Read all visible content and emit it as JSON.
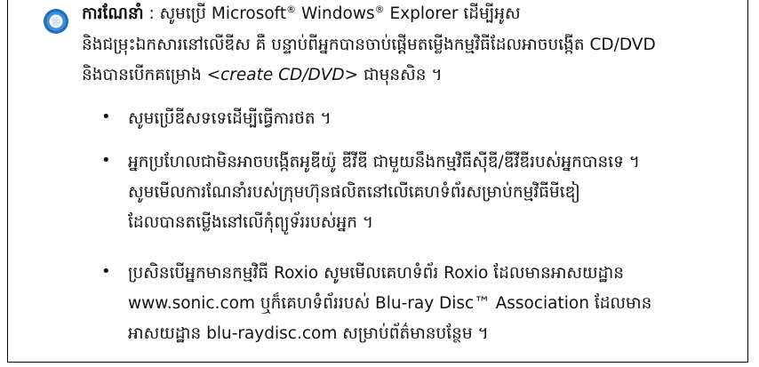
{
  "note": {
    "label": "ការណែនាំ",
    "colon": " : ",
    "line1_a": "សូមប្រើ Microsoft",
    "reg1": "®",
    "line1_b": " Windows",
    "reg2": "®",
    "line1_c": " Explorer ដើម្បីអូស",
    "line2": "និងជម្រុះឯកសារនៅលើឌីស គឺ បន្ទាប់ពីអ្នកបានចាប់ផ្តើមតម្លើងកម្មវិធីដែលអាចបង្កើត CD/DVD",
    "line3_a": "និងបានបើកគម្រោង <",
    "line3_italic": "create CD/DVD",
    "line3_b": "> ជាមុនសិន ។"
  },
  "bullets": [
    {
      "lines": [
        "សូមប្រើឌីសទទេដើម្បីធ្វើការថត ។"
      ]
    },
    {
      "lines": [
        "អ្នកប្រហែលជាមិនអាចបង្កើតអូឌីយ៉ូ ឌីវីឌី ជាមួយនឹងកម្មវិធីស៊ីឌី/ឌីវីឌីរបស់អ្នកបានទេ ។",
        "សូមមើលការណែនាំរបស់ក្រុមហ៊ុនផលិតនៅលើគេហទំព័រសម្រាប់កម្មវិធីមីឌៀ",
        "ដែលបានតម្លើងនៅលើកុំព្យូទ័ររបស់អ្នក ។"
      ]
    },
    {
      "lines": [
        "ប្រសិនបើអ្នកមានកម្មវិធី Roxio សូមមើលគេហទំព័រ Roxio ដែលមានអាសយដ្ឋាន",
        "www.sonic.com ឬក៏គេហទំព័ររបស់ Blu-ray Disc™ Association ដែលមាន",
        "អាសយដ្ឋាន blu-raydisc.com សម្រាប់ព័ត៌មានបន្ថែម ។"
      ]
    }
  ],
  "bullet_glyph": "•",
  "icon": "note-info-icon",
  "colors": {
    "icon_outer": "#1f6fb8",
    "icon_inner": "#ffffff",
    "border": "#000000"
  }
}
